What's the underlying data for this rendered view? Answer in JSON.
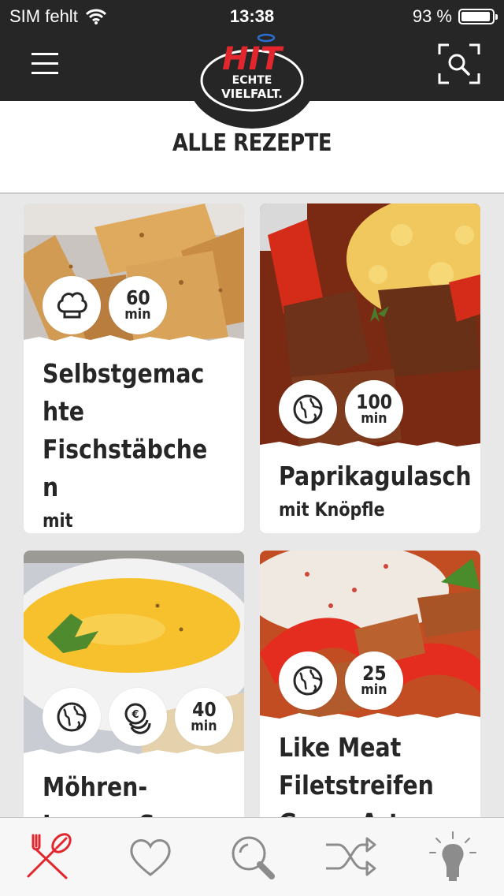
{
  "status": {
    "carrier": "SIM fehlt",
    "time": "13:38",
    "battery": "93 %"
  },
  "brand": {
    "name": "HIT",
    "tagline_1": "ECHTE",
    "tagline_2": "VIELFALT."
  },
  "page": {
    "title": "ALLE REZEPTE"
  },
  "recipes": [
    {
      "title": "Selbstgemachte Fischstäbchen",
      "subtitle": "mit Remouladensauce",
      "minutes": "60",
      "unit": "min",
      "badges": [
        "chef-hat-icon"
      ]
    },
    {
      "title": "Paprikagulasch",
      "subtitle": "mit Knöpfle",
      "minutes": "100",
      "unit": "min",
      "badges": [
        "globe-icon"
      ]
    },
    {
      "title": "Möhren-Ingwer-Suppe",
      "subtitle": "",
      "minutes": "40",
      "unit": "min",
      "badges": [
        "globe-icon",
        "coins-icon"
      ]
    },
    {
      "title": "Like Meat Filetstreifen Gyros-Art",
      "subtitle": "",
      "minutes": "25",
      "unit": "min",
      "badges": [
        "globe-icon"
      ]
    }
  ],
  "tabs": [
    "recipes-icon",
    "heart-icon",
    "search-icon",
    "shuffle-icon",
    "lightbulb-icon"
  ],
  "colors": {
    "accent": "#e3262e",
    "bar": "#262626",
    "icon_gray": "#8c8c8c"
  }
}
